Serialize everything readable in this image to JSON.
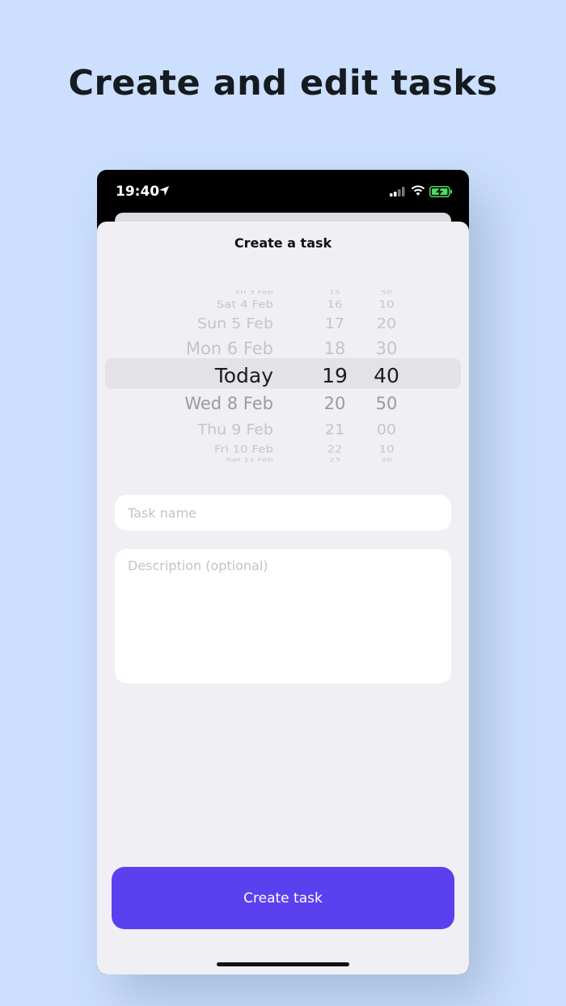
{
  "headline": "Create and edit tasks",
  "status_bar": {
    "time": "19:40",
    "icons": [
      "location-arrow-icon",
      "cellular-signal-icon",
      "wifi-icon",
      "battery-charging-icon"
    ],
    "battery_color": "#4cd964"
  },
  "sheet": {
    "title": "Create a task"
  },
  "picker": {
    "rows": [
      {
        "date": "Fri 3 Feb",
        "hour": "15",
        "minute": "50"
      },
      {
        "date": "Sat 4 Feb",
        "hour": "16",
        "minute": "10"
      },
      {
        "date": "Sun 5 Feb",
        "hour": "17",
        "minute": "20"
      },
      {
        "date": "Mon 6 Feb",
        "hour": "18",
        "minute": "30"
      },
      {
        "date": "Today",
        "hour": "19",
        "minute": "40"
      },
      {
        "date": "Wed 8 Feb",
        "hour": "20",
        "minute": "50"
      },
      {
        "date": "Thu 9 Feb",
        "hour": "21",
        "minute": "00"
      },
      {
        "date": "Fri 10 Feb",
        "hour": "22",
        "minute": "10"
      },
      {
        "date": "Sat 11 Feb",
        "hour": "23",
        "minute": "20"
      }
    ],
    "selected_index": 4
  },
  "form": {
    "task_name_placeholder": "Task name",
    "description_placeholder": "Description (optional)"
  },
  "create_button_label": "Create task",
  "colors": {
    "background": "#cce0fd",
    "accent": "#5b40f0"
  }
}
